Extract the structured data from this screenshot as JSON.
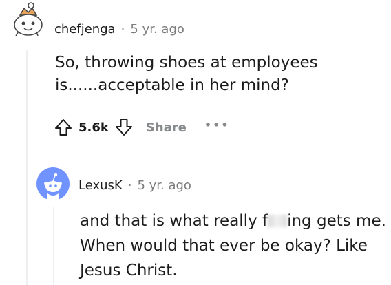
{
  "comment1": {
    "author": "chefjenga",
    "separator": "·",
    "time": "5 yr. ago",
    "body": "So, throwing shoes at employees is......acceptable in her mind?",
    "score": "5.6k",
    "share_label": "Share",
    "more_label": "•••"
  },
  "comment2": {
    "author": "LexusK",
    "separator": "·",
    "time": "5 yr. ago",
    "body_before": "and that is what really f",
    "body_after": "ing gets me. When would that ever be okay? Like Jesus Christ."
  },
  "colors": {
    "text": "#1c1c1c",
    "meta": "#7c7c7c",
    "avatar_blue": "#7193ff",
    "thread_line": "#edeff1"
  }
}
